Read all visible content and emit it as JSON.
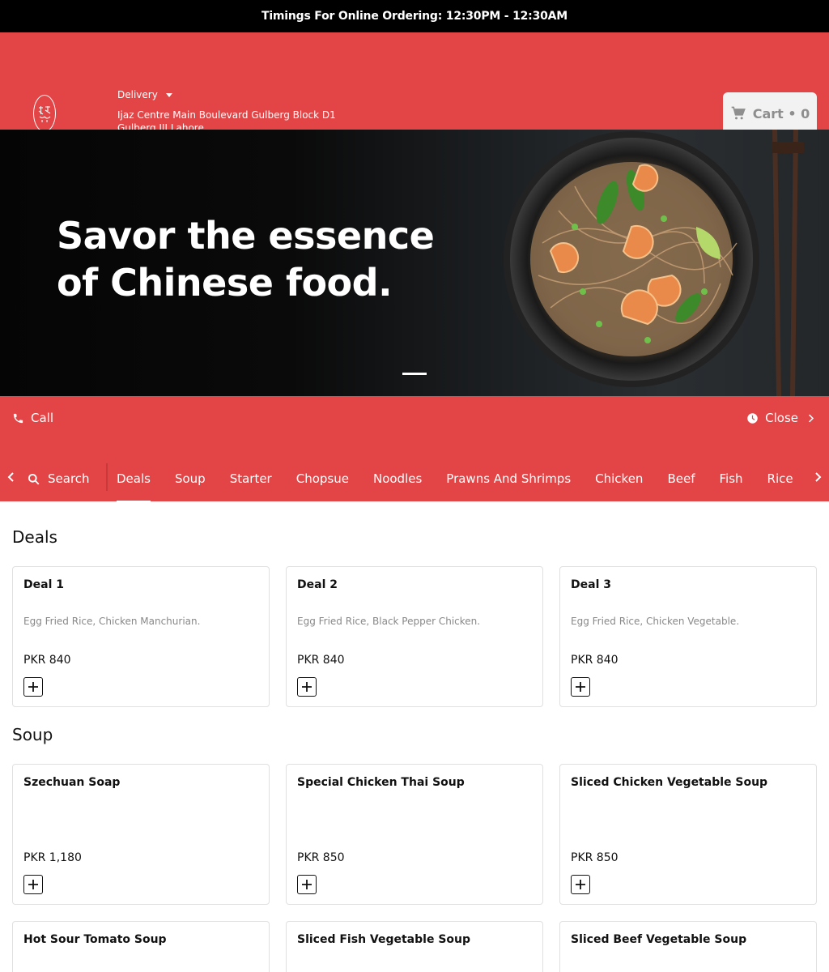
{
  "topbar": {
    "timings": "Timings For Online Ordering: 12:30PM - 12:30AM"
  },
  "header": {
    "delivery_label": "Delivery",
    "address": "Ijaz Centre Main Boulevard Gulberg Block D1 Gulberg III Lahore",
    "cart_label": "Cart • 0",
    "brand_color": "#e34446"
  },
  "hero": {
    "line1": "Savor the essence",
    "line2": "of Chinese food."
  },
  "info": {
    "call": "Call",
    "status": "Close"
  },
  "nav": {
    "search": "Search",
    "tabs": [
      "Deals",
      "Soup",
      "Starter",
      "Chopsue",
      "Noodles",
      "Prawns And Shrimps",
      "Chicken",
      "Beef",
      "Fish",
      "Rice"
    ]
  },
  "sections": [
    {
      "title": "Deals",
      "items": [
        {
          "name": "Deal 1",
          "desc": "Egg Fried Rice, Chicken Manchurian.",
          "price": "PKR 840"
        },
        {
          "name": "Deal 2",
          "desc": "Egg Fried Rice, Black Pepper Chicken.",
          "price": "PKR 840"
        },
        {
          "name": "Deal 3",
          "desc": "Egg Fried Rice, Chicken Vegetable.",
          "price": "PKR 840"
        }
      ]
    },
    {
      "title": "Soup",
      "items": [
        {
          "name": "Szechuan Soap",
          "desc": "",
          "price": "PKR 1,180"
        },
        {
          "name": "Special Chicken Thai Soup",
          "desc": "",
          "price": "PKR 850"
        },
        {
          "name": "Sliced Chicken Vegetable Soup",
          "desc": "",
          "price": "PKR 850"
        },
        {
          "name": "Hot Sour Tomato Soup",
          "desc": "",
          "price": ""
        },
        {
          "name": "Sliced Fish Vegetable Soup",
          "desc": "",
          "price": ""
        },
        {
          "name": "Sliced Beef Vegetable Soup",
          "desc": "",
          "price": ""
        }
      ]
    }
  ]
}
